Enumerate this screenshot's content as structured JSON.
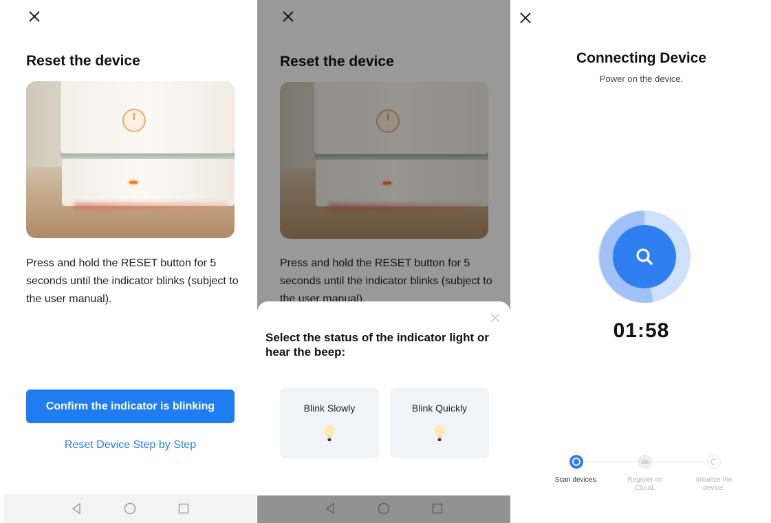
{
  "screen1": {
    "title": "Reset the device",
    "description": "Press and hold the RESET button for 5 seconds until the indicator blinks (subject to the user manual).",
    "confirm_button": "Confirm the indicator is blinking",
    "step_link": "Reset Device Step by Step"
  },
  "screen2": {
    "title": "Reset the device",
    "description": "Press and hold the RESET button for 5 seconds until the indicator blinks (subject to the user manual).",
    "sheet_title": "Select the status of the indicator light or hear the beep:",
    "options": [
      {
        "label": "Blink Slowly",
        "icon": "bulb-icon"
      },
      {
        "label": "Blink Quickly",
        "icon": "bulb-icon"
      }
    ]
  },
  "screen3": {
    "title": "Connecting Device",
    "subtitle": "Power on the device.",
    "timer": "01:58",
    "steps": [
      {
        "label": "Scan devices.",
        "active": true
      },
      {
        "label": "Register on Cloud.",
        "active": false
      },
      {
        "label": "Initialize the device.",
        "active": false
      }
    ]
  },
  "colors": {
    "accent": "#1f7cf1",
    "link": "#2a7de1",
    "ring_outer": "#b9d3fb",
    "ring_inner": "#2f7ff0"
  }
}
